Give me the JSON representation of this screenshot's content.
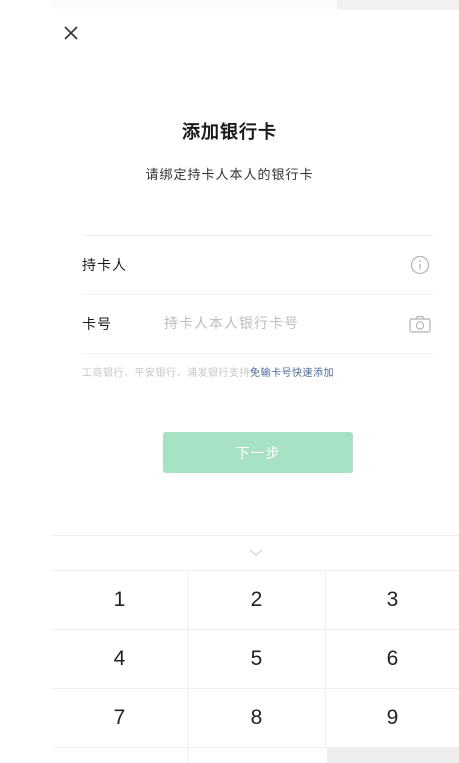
{
  "header": {
    "close_icon": "close-icon"
  },
  "page": {
    "title": "添加银行卡",
    "subtitle": "请绑定持卡人本人的银行卡"
  },
  "form": {
    "holder_label": "持卡人",
    "holder_value": "",
    "holder_icon": "info-icon",
    "card_label": "卡号",
    "card_placeholder": "持卡人本人银行卡号",
    "card_icon": "camera-icon"
  },
  "hint": {
    "prefix": "工商银行、平安银行、浦发银行支持",
    "link": "免输卡号快速添加"
  },
  "actions": {
    "next_label": "下一步"
  },
  "keyboard": {
    "collapse_icon": "chevron-down-icon",
    "keys": [
      "1",
      "2",
      "3",
      "4",
      "5",
      "6",
      "7",
      "8",
      "9"
    ]
  },
  "colors": {
    "button_bg": "#a8e2c4",
    "link": "#4b6a9b",
    "placeholder": "#bdbdbd"
  }
}
